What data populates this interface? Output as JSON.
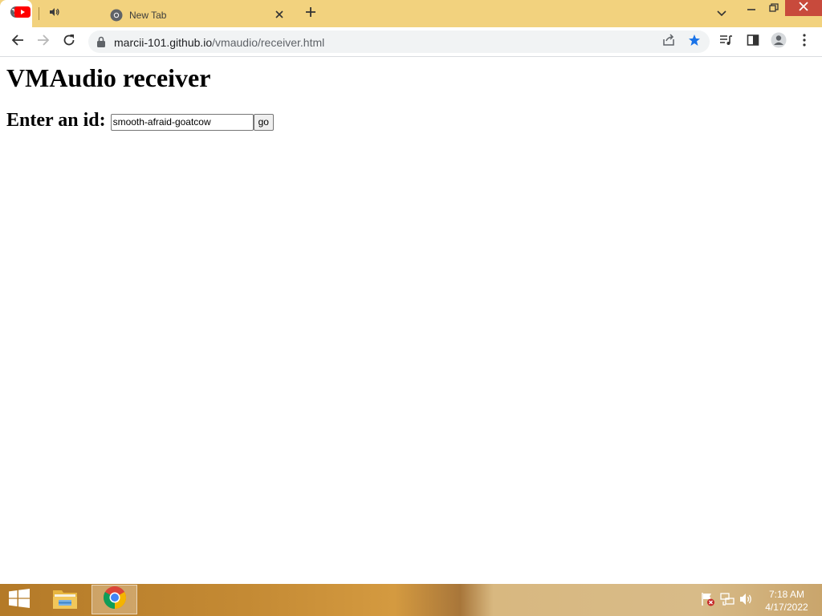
{
  "tabs": {
    "active_tab_title": "",
    "second_tab_title": "New Tab"
  },
  "toolbar": {
    "url_domain": "marcii-101.github.io",
    "url_path": "/vmaudio/receiver.html"
  },
  "page": {
    "heading": "VMAudio receiver",
    "form_label": "Enter an id:",
    "id_value": "smooth-afraid-goatcow",
    "go_label": "go"
  },
  "taskbar": {
    "time": "7:18 AM",
    "date": "4/17/2022"
  },
  "icons": {
    "pinned_tab_1": "youtube-icon",
    "pinned_tab_2": "speaker-icon",
    "active_tab": "globe-icon",
    "new_tab_favicon": "chrome-icon",
    "bookmark": "star-icon"
  },
  "colors": {
    "tabstrip": "#f2d27e",
    "close_button": "#c84a3c",
    "star": "#1a73e8",
    "youtube_red": "#ff0000"
  }
}
